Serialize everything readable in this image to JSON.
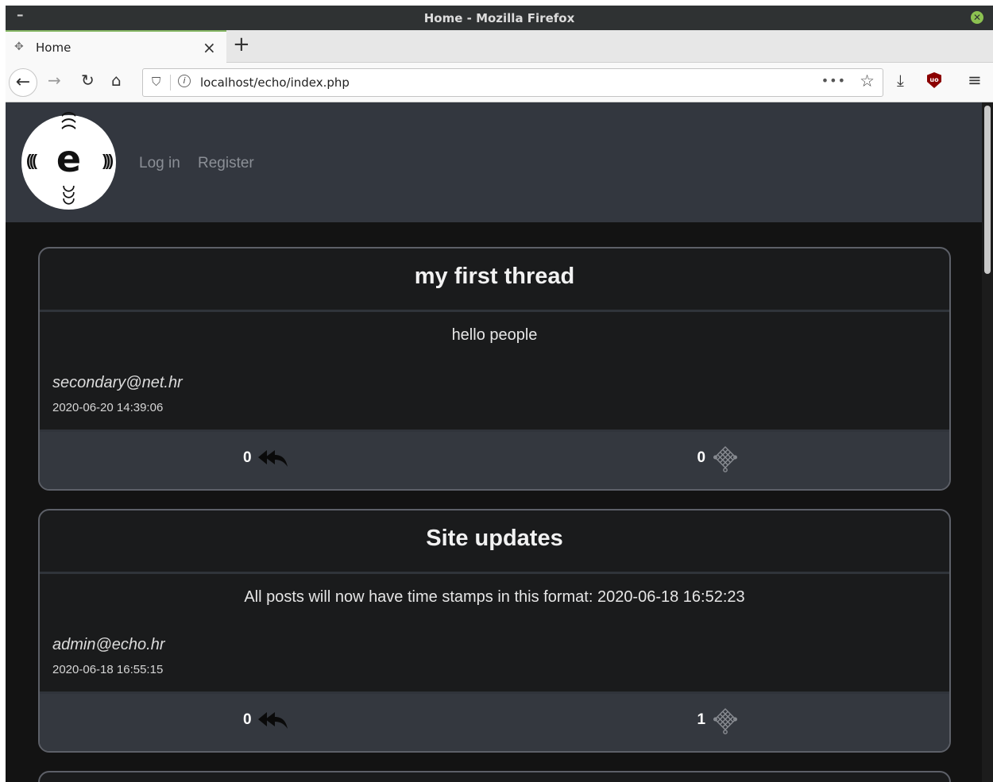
{
  "window": {
    "title": "Home - Mozilla Firefox",
    "minimize": "–"
  },
  "browser": {
    "tab_title": "Home",
    "tab_close": "×",
    "new_tab": "+",
    "url": "localhost/echo/index.php",
    "url_more": "•••"
  },
  "site": {
    "nav": [
      {
        "label": "Log in"
      },
      {
        "label": "Register"
      }
    ]
  },
  "threads": [
    {
      "title": "my first thread",
      "text": "hello people",
      "author": "secondary@net.hr",
      "date": "2020-06-20 14:39:06",
      "replies": "0",
      "knots": "0"
    },
    {
      "title": "Site updates",
      "text": "All posts will now have time stamps in this format: 2020-06-18 16:52:23",
      "author": "admin@echo.hr",
      "date": "2020-06-18 16:55:15",
      "replies": "0",
      "knots": "1"
    }
  ],
  "colors": {
    "header_bg": "#33373f",
    "page_bg": "#131313",
    "card_footer_bg": "#34383f",
    "tab_accent": "#87b966"
  },
  "icons": [
    "window-close-icon",
    "tab-favicon-icon",
    "back-arrow-icon",
    "forward-arrow-icon",
    "reload-icon",
    "home-icon",
    "shield-icon",
    "info-icon",
    "bookmark-star-icon",
    "download-icon",
    "ublock-icon",
    "hamburger-menu-icon",
    "reply-all-icon",
    "knot-icon"
  ]
}
